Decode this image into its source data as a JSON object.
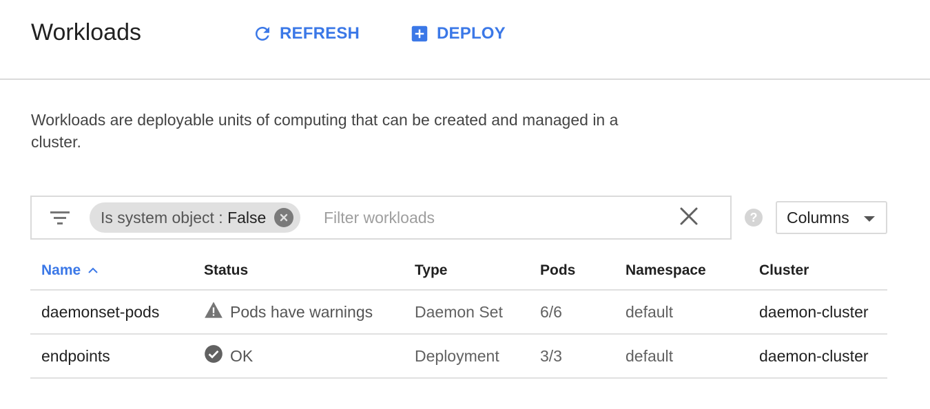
{
  "header": {
    "title": "Workloads",
    "refresh_label": "REFRESH",
    "deploy_label": "DEPLOY"
  },
  "description": "Workloads are deployable units of computing that can be created and managed in a cluster.",
  "filter": {
    "chip_key": "Is system object",
    "chip_separator": ":",
    "chip_value": "False",
    "placeholder": "Filter workloads"
  },
  "columns_button": "Columns",
  "table": {
    "headers": {
      "name": "Name",
      "status": "Status",
      "type": "Type",
      "pods": "Pods",
      "namespace": "Namespace",
      "cluster": "Cluster"
    },
    "rows": [
      {
        "name": "daemonset-pods",
        "status": "Pods have warnings",
        "status_icon": "warning-icon",
        "type": "Daemon Set",
        "pods": "6/6",
        "namespace": "default",
        "cluster": "daemon-cluster"
      },
      {
        "name": "endpoints",
        "status": "OK",
        "status_icon": "check-circle-icon",
        "type": "Deployment",
        "pods": "3/3",
        "namespace": "default",
        "cluster": "daemon-cluster"
      }
    ]
  },
  "colors": {
    "accent": "#3b78e7",
    "divider": "#dadada",
    "chip_bg": "#e0e0e0",
    "status_icon": "#616161"
  }
}
